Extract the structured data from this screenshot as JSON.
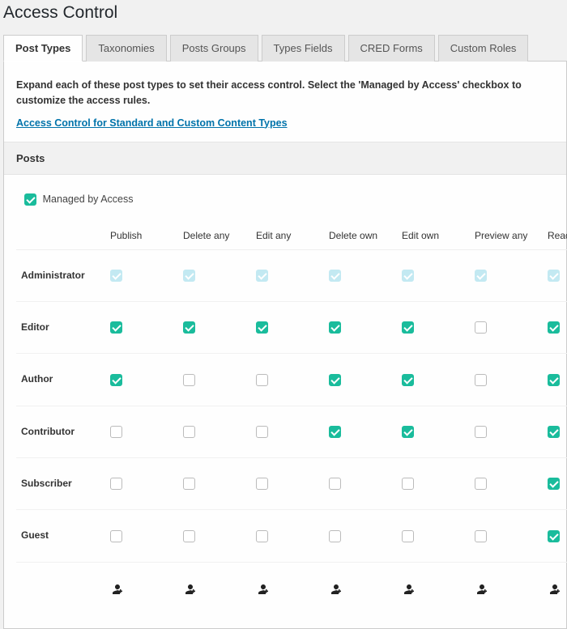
{
  "pageTitle": "Access Control",
  "tabs": [
    "Post Types",
    "Taxonomies",
    "Posts Groups",
    "Types Fields",
    "CRED Forms",
    "Custom Roles"
  ],
  "activeTab": 0,
  "intro": "Expand each of these post types to set their access control. Select the 'Managed by Access' checkbox to customize the access rules.",
  "helpLinkText": "Access Control for Standard and Custom Content Types",
  "section": {
    "title": "Posts",
    "managedLabel": "Managed by Access",
    "managedChecked": true,
    "columns": [
      "Publish",
      "Delete any",
      "Edit any",
      "Delete own",
      "Edit own",
      "Preview any",
      "Read"
    ],
    "readHasEditIcon": true,
    "roles": [
      {
        "name": "Administrator",
        "disabled": true,
        "perms": [
          true,
          true,
          true,
          true,
          true,
          true,
          true
        ]
      },
      {
        "name": "Editor",
        "disabled": false,
        "perms": [
          true,
          true,
          true,
          true,
          true,
          false,
          true
        ]
      },
      {
        "name": "Author",
        "disabled": false,
        "perms": [
          true,
          false,
          false,
          true,
          true,
          false,
          true
        ]
      },
      {
        "name": "Contributor",
        "disabled": false,
        "perms": [
          false,
          false,
          false,
          true,
          true,
          false,
          true
        ]
      },
      {
        "name": "Subscriber",
        "disabled": false,
        "perms": [
          false,
          false,
          false,
          false,
          false,
          false,
          true
        ]
      },
      {
        "name": "Guest",
        "disabled": false,
        "perms": [
          false,
          false,
          false,
          false,
          false,
          false,
          true
        ]
      }
    ]
  }
}
